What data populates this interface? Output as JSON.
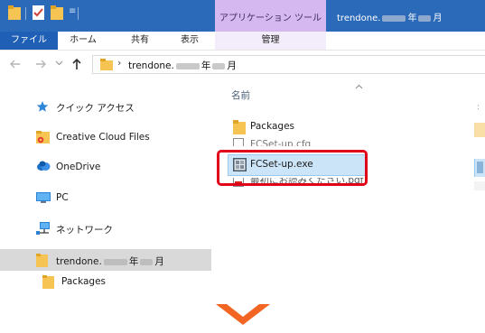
{
  "window": {
    "title_prefix": "trendone.",
    "title_year": "年",
    "title_month": "月",
    "context_tab": "アプリケーション ツール"
  },
  "ribbon": {
    "tabs": [
      {
        "label": "ファイル",
        "active": true
      },
      {
        "label": "ホーム"
      },
      {
        "label": "共有"
      },
      {
        "label": "表示"
      },
      {
        "label": "管理"
      }
    ]
  },
  "address": {
    "back_icon": "left-arrow-icon",
    "forward_icon": "right-arrow-icon",
    "recent_icon": "chevron-down-icon",
    "up_icon": "up-arrow-icon",
    "separator": "›",
    "path_prefix": "trendone.",
    "path_year": "年",
    "path_month": "月"
  },
  "nav_pane": {
    "items": [
      {
        "label": "クイック アクセス",
        "icon": "star-icon"
      },
      {
        "label": "Creative Cloud Files",
        "icon": "creative-cloud-icon"
      },
      {
        "label": "OneDrive",
        "icon": "cloud-icon"
      },
      {
        "label": "PC",
        "icon": "monitor-icon"
      },
      {
        "label": "ネットワーク",
        "icon": "network-icon"
      },
      {
        "label_prefix": "trendone.",
        "label_year": "年",
        "label_month": "月",
        "icon": "folder-icon",
        "selected": true
      },
      {
        "label": "Packages",
        "icon": "folder-icon"
      }
    ]
  },
  "file_pane": {
    "column_name": "名前",
    "sort_icon": "chevron-up-icon",
    "files": [
      {
        "name": "Packages",
        "icon": "folder-icon"
      },
      {
        "name": "FCSet-up.cfg",
        "icon": "document-icon",
        "partially_hidden": true
      },
      {
        "name": "FCSet-up.exe",
        "icon": "installer-icon",
        "selected": true
      },
      {
        "name": "最初にお読みください.pdf",
        "icon": "pdf-icon",
        "partially_hidden": true
      }
    ]
  },
  "colors": {
    "title_bar": "#2b6ab8",
    "context_tab": "#d6b8f0",
    "file_tab": "#1f5fb6",
    "selection": "#cce4f7",
    "nav_selection": "#d9d9d9",
    "highlight": "#e0001a",
    "arrow": "#f26522"
  }
}
